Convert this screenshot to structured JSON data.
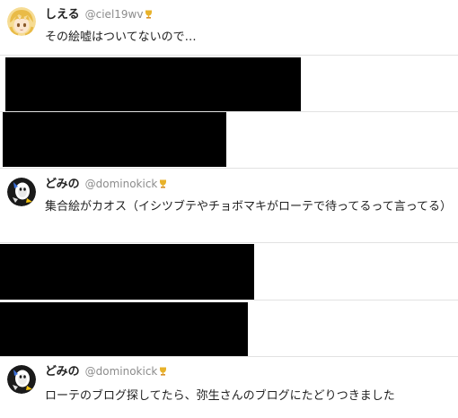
{
  "posts": [
    {
      "display_name": "しえる",
      "handle": "@ciel19wv",
      "text": "その絵嘘はついてないので…",
      "avatar_icon": "anime-girl-avatar-icon",
      "badge_icon": "trophy-badge-icon"
    },
    {
      "display_name": "どみの",
      "handle": "@dominokick",
      "text": "集合絵がカオス（イシツブテやチョボマキがローテで待ってるって言ってる）",
      "avatar_icon": "pokemon-avatar-icon",
      "badge_icon": "trophy-badge-icon"
    },
    {
      "display_name": "どみの",
      "handle": "@dominokick",
      "text": "ローテのブログ探してたら、弥生さんのブログにたどりつきました",
      "avatar_icon": "pokemon-avatar-icon",
      "badge_icon": "trophy-badge-icon"
    }
  ],
  "colors": {
    "background": "#ffffff",
    "divider": "#e2e2e2",
    "text": "#222222",
    "handle": "#8c8c8c",
    "redaction": "#000000",
    "badge": "#e8b22a"
  }
}
